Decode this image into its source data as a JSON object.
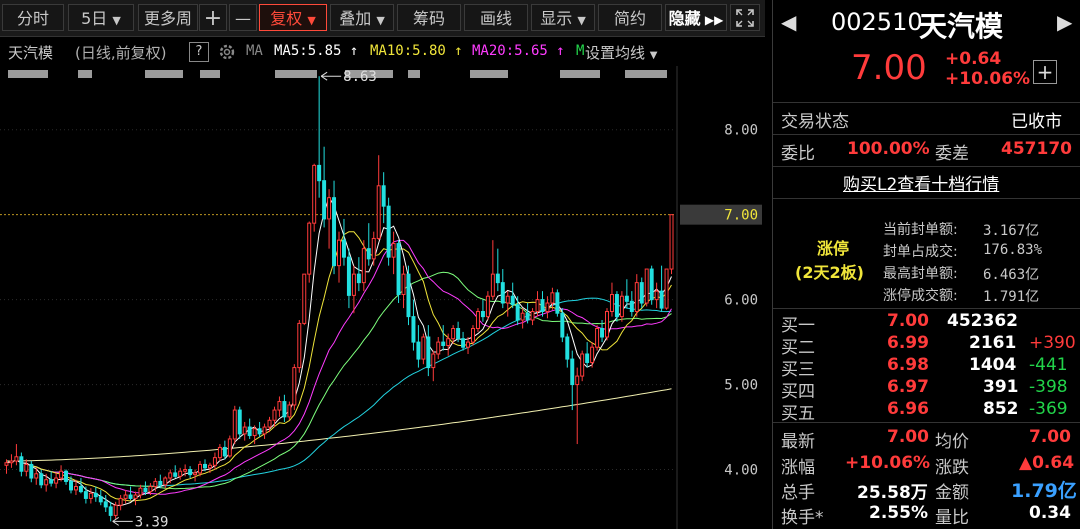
{
  "toolbar": {
    "items": [
      "分时",
      "5日",
      "更多周",
      "复权",
      "叠加",
      "筹码",
      "画线",
      "显示",
      "简约",
      "隐藏"
    ],
    "plus": "+",
    "minus": "—",
    "expand_icon": "expand-arrows-icon"
  },
  "chart_header": {
    "name": "天汽模",
    "mode": "(日线,前复权)",
    "help": "?",
    "ma_label": "MA",
    "ma5": "MA5:5.85",
    "ma10": "MA10:5.80",
    "ma20": "MA20:5.65",
    "ma_more": "M",
    "settings": "设置均线",
    "colors": {
      "ma5": "#ffffff",
      "ma10": "#f0e53a",
      "ma20": "#ff3cff",
      "ma_long": "#22d3e0",
      "ma_year": "#f2f0b0"
    }
  },
  "chart_data": {
    "type": "candlestick",
    "y_ticks": [
      "8.00",
      "7.00",
      "6.00",
      "5.00",
      "4.00"
    ],
    "ylim": [
      3.3,
      8.75
    ],
    "current_price_line": 7.0,
    "annotations": [
      {
        "text": "8.63",
        "value": 8.63,
        "kind": "high"
      },
      {
        "text": "3.39",
        "value": 3.39,
        "kind": "low"
      }
    ],
    "candles": [
      [
        4.05,
        4.12,
        3.95,
        4.08
      ],
      [
        4.08,
        4.18,
        4.02,
        4.1
      ],
      [
        4.1,
        4.3,
        4.05,
        4.15
      ],
      [
        4.15,
        4.2,
        3.92,
        3.98
      ],
      [
        3.98,
        4.12,
        3.92,
        4.06
      ],
      [
        4.06,
        4.1,
        3.85,
        3.9
      ],
      [
        3.9,
        4.02,
        3.82,
        3.95
      ],
      [
        3.95,
        4.0,
        3.78,
        3.82
      ],
      [
        3.82,
        3.95,
        3.74,
        3.88
      ],
      [
        3.88,
        3.98,
        3.8,
        3.84
      ],
      [
        3.84,
        3.96,
        3.78,
        3.9
      ],
      [
        3.9,
        4.05,
        3.86,
        3.98
      ],
      [
        3.98,
        4.0,
        3.82,
        3.86
      ],
      [
        3.86,
        3.92,
        3.72,
        3.76
      ],
      [
        3.76,
        3.88,
        3.7,
        3.8
      ],
      [
        3.8,
        3.9,
        3.72,
        3.74
      ],
      [
        3.74,
        3.8,
        3.6,
        3.66
      ],
      [
        3.66,
        3.78,
        3.6,
        3.72
      ],
      [
        3.72,
        3.8,
        3.62,
        3.68
      ],
      [
        3.68,
        3.76,
        3.58,
        3.62
      ],
      [
        3.62,
        3.7,
        3.5,
        3.56
      ],
      [
        3.56,
        3.62,
        3.39,
        3.46
      ],
      [
        3.46,
        3.62,
        3.42,
        3.58
      ],
      [
        3.58,
        3.7,
        3.52,
        3.66
      ],
      [
        3.66,
        3.76,
        3.6,
        3.7
      ],
      [
        3.7,
        3.8,
        3.64,
        3.66
      ],
      [
        3.66,
        3.74,
        3.58,
        3.7
      ],
      [
        3.7,
        3.82,
        3.66,
        3.78
      ],
      [
        3.78,
        3.86,
        3.7,
        3.74
      ],
      [
        3.74,
        3.84,
        3.7,
        3.8
      ],
      [
        3.8,
        3.9,
        3.74,
        3.86
      ],
      [
        3.86,
        3.94,
        3.78,
        3.82
      ],
      [
        3.82,
        3.92,
        3.78,
        3.9
      ],
      [
        3.9,
        4.0,
        3.84,
        3.96
      ],
      [
        3.96,
        4.05,
        3.9,
        3.92
      ],
      [
        3.92,
        4.02,
        3.88,
        3.98
      ],
      [
        3.98,
        4.06,
        3.92,
        4.0
      ],
      [
        4.0,
        4.04,
        3.9,
        3.94
      ],
      [
        3.94,
        4.0,
        3.86,
        3.96
      ],
      [
        3.96,
        4.1,
        3.92,
        4.06
      ],
      [
        4.06,
        4.12,
        3.98,
        4.02
      ],
      [
        4.02,
        4.08,
        3.96,
        4.05
      ],
      [
        4.05,
        4.2,
        4.0,
        4.14
      ],
      [
        4.14,
        4.3,
        4.1,
        4.26
      ],
      [
        4.26,
        4.34,
        4.12,
        4.16
      ],
      [
        4.16,
        4.4,
        4.14,
        4.36
      ],
      [
        4.36,
        4.75,
        4.3,
        4.7
      ],
      [
        4.7,
        4.74,
        4.36,
        4.42
      ],
      [
        4.42,
        4.56,
        4.34,
        4.5
      ],
      [
        4.5,
        4.6,
        4.36,
        4.4
      ],
      [
        4.4,
        4.52,
        4.3,
        4.48
      ],
      [
        4.48,
        4.56,
        4.38,
        4.42
      ],
      [
        4.42,
        4.54,
        4.36,
        4.5
      ],
      [
        4.5,
        4.62,
        4.44,
        4.58
      ],
      [
        4.58,
        4.74,
        4.5,
        4.7
      ],
      [
        4.7,
        4.86,
        4.62,
        4.8
      ],
      [
        4.8,
        4.88,
        4.56,
        4.62
      ],
      [
        4.62,
        4.8,
        4.58,
        4.76
      ],
      [
        4.76,
        5.24,
        4.7,
        5.2
      ],
      [
        5.2,
        5.76,
        5.14,
        5.72
      ],
      [
        5.72,
        6.3,
        5.7,
        6.3
      ],
      [
        6.3,
        6.92,
        6.2,
        6.9
      ],
      [
        6.9,
        7.6,
        6.8,
        7.58
      ],
      [
        7.58,
        8.63,
        7.2,
        7.4
      ],
      [
        7.4,
        7.8,
        6.85,
        6.95
      ],
      [
        6.95,
        7.3,
        6.6,
        7.2
      ],
      [
        7.2,
        7.4,
        6.3,
        6.4
      ],
      [
        6.4,
        6.8,
        6.2,
        6.7
      ],
      [
        6.7,
        6.95,
        6.4,
        6.5
      ],
      [
        6.5,
        6.6,
        5.9,
        6.05
      ],
      [
        6.05,
        6.4,
        5.84,
        6.3
      ],
      [
        6.3,
        6.5,
        6.1,
        6.2
      ],
      [
        6.2,
        6.7,
        6.1,
        6.6
      ],
      [
        6.6,
        6.9,
        6.4,
        6.48
      ],
      [
        6.48,
        6.8,
        6.4,
        6.72
      ],
      [
        6.72,
        7.7,
        6.7,
        7.34
      ],
      [
        7.34,
        7.5,
        6.9,
        7.1
      ],
      [
        7.1,
        7.2,
        6.4,
        6.5
      ],
      [
        6.5,
        6.8,
        6.3,
        6.66
      ],
      [
        6.66,
        6.7,
        5.96,
        6.06
      ],
      [
        6.06,
        6.4,
        5.9,
        6.3
      ],
      [
        6.3,
        6.4,
        5.7,
        5.8
      ],
      [
        5.8,
        6.0,
        5.4,
        5.5
      ],
      [
        5.5,
        5.7,
        5.2,
        5.3
      ],
      [
        5.3,
        5.6,
        5.24,
        5.56
      ],
      [
        5.56,
        5.7,
        5.1,
        5.2
      ],
      [
        5.2,
        5.4,
        5.04,
        5.36
      ],
      [
        5.36,
        5.56,
        5.3,
        5.5
      ],
      [
        5.5,
        5.7,
        5.4,
        5.46
      ],
      [
        5.46,
        5.6,
        5.34,
        5.54
      ],
      [
        5.54,
        5.7,
        5.48,
        5.66
      ],
      [
        5.66,
        5.74,
        5.5,
        5.54
      ],
      [
        5.54,
        5.62,
        5.4,
        5.44
      ],
      [
        5.44,
        5.56,
        5.36,
        5.5
      ],
      [
        5.5,
        5.7,
        5.46,
        5.66
      ],
      [
        5.66,
        5.9,
        5.62,
        5.86
      ],
      [
        5.86,
        6.0,
        5.74,
        5.8
      ],
      [
        5.8,
        6.1,
        5.76,
        6.04
      ],
      [
        6.04,
        6.7,
        6.0,
        6.3
      ],
      [
        6.3,
        6.6,
        6.1,
        6.2
      ],
      [
        6.2,
        6.36,
        5.9,
        5.96
      ],
      [
        5.96,
        6.1,
        5.8,
        6.04
      ],
      [
        6.04,
        6.2,
        5.9,
        5.94
      ],
      [
        5.94,
        6.04,
        5.7,
        5.76
      ],
      [
        5.76,
        5.9,
        5.66,
        5.84
      ],
      [
        5.84,
        5.96,
        5.72,
        5.76
      ],
      [
        5.76,
        5.9,
        5.7,
        5.86
      ],
      [
        5.86,
        6.1,
        5.8,
        6.0
      ],
      [
        6.0,
        6.1,
        5.8,
        5.86
      ],
      [
        5.86,
        6.04,
        5.78,
        5.96
      ],
      [
        5.96,
        6.14,
        5.88,
        6.08
      ],
      [
        6.08,
        6.12,
        5.8,
        5.84
      ],
      [
        5.84,
        5.9,
        5.5,
        5.56
      ],
      [
        5.56,
        5.6,
        5.2,
        5.3
      ],
      [
        5.3,
        5.4,
        4.7,
        5.0
      ],
      [
        5.0,
        5.2,
        4.3,
        5.1
      ],
      [
        5.1,
        5.4,
        5.04,
        5.36
      ],
      [
        5.36,
        5.5,
        5.2,
        5.26
      ],
      [
        5.26,
        5.5,
        5.2,
        5.44
      ],
      [
        5.44,
        5.7,
        5.4,
        5.66
      ],
      [
        5.66,
        5.76,
        5.5,
        5.56
      ],
      [
        5.56,
        5.9,
        5.52,
        5.86
      ],
      [
        5.86,
        6.2,
        5.8,
        6.06
      ],
      [
        6.06,
        6.1,
        5.74,
        5.8
      ],
      [
        5.8,
        6.1,
        5.74,
        6.04
      ],
      [
        6.04,
        6.24,
        5.9,
        5.98
      ],
      [
        5.98,
        6.1,
        5.8,
        5.86
      ],
      [
        5.86,
        6.3,
        5.8,
        6.2
      ],
      [
        6.2,
        6.26,
        5.9,
        5.96
      ],
      [
        5.96,
        6.3,
        5.92,
        6.36
      ],
      [
        6.36,
        6.4,
        5.94,
        6.0
      ],
      [
        6.0,
        6.2,
        5.9,
        6.1
      ],
      [
        6.1,
        6.4,
        5.86,
        5.9
      ],
      [
        5.9,
        6.2,
        5.88,
        6.36
      ],
      [
        6.36,
        7.0,
        6.3,
        7.0
      ]
    ]
  },
  "stock": {
    "code": "002510",
    "name": "天汽模",
    "price": "7.00",
    "change": "+0.64",
    "change_pct": "+10.06%"
  },
  "trade_status": {
    "label": "交易状态",
    "value": "已收市"
  },
  "order_ratio": {
    "label": "委比",
    "value": "100.00%",
    "diff_label": "委差",
    "diff_value": "457170"
  },
  "l2_link": "购买L2查看十档行情",
  "limit_up": {
    "title": "涨停",
    "subtitle": "(2天2板)",
    "rows": [
      {
        "label": "当前封单额:",
        "value": "3.167亿"
      },
      {
        "label": "封单占成交:",
        "value": "176.83%"
      },
      {
        "label": "最高封单额:",
        "value": "6.463亿"
      },
      {
        "label": "涨停成交额:",
        "value": "1.791亿"
      }
    ]
  },
  "bids": [
    {
      "label": "买一",
      "price": "7.00",
      "volume": "452362",
      "delta": ""
    },
    {
      "label": "买二",
      "price": "6.99",
      "volume": "2161",
      "delta": "+390"
    },
    {
      "label": "买三",
      "price": "6.98",
      "volume": "1404",
      "delta": "-441"
    },
    {
      "label": "买四",
      "price": "6.97",
      "volume": "391",
      "delta": "-398"
    },
    {
      "label": "买五",
      "price": "6.96",
      "volume": "852",
      "delta": "-369"
    }
  ],
  "stats": {
    "latest_label": "最新",
    "latest": "7.00",
    "avg_label": "均价",
    "avg": "7.00",
    "pct_label": "涨幅",
    "pct": "+10.06%",
    "chg_label": "涨跌",
    "chg": "▲0.64",
    "vol_label": "总手",
    "vol": "25.58万",
    "amt_label": "金额",
    "amt": "1.79亿",
    "turn_label": "换手*",
    "turn": "2.55%",
    "vr_label": "量比",
    "vr": "0.34"
  }
}
